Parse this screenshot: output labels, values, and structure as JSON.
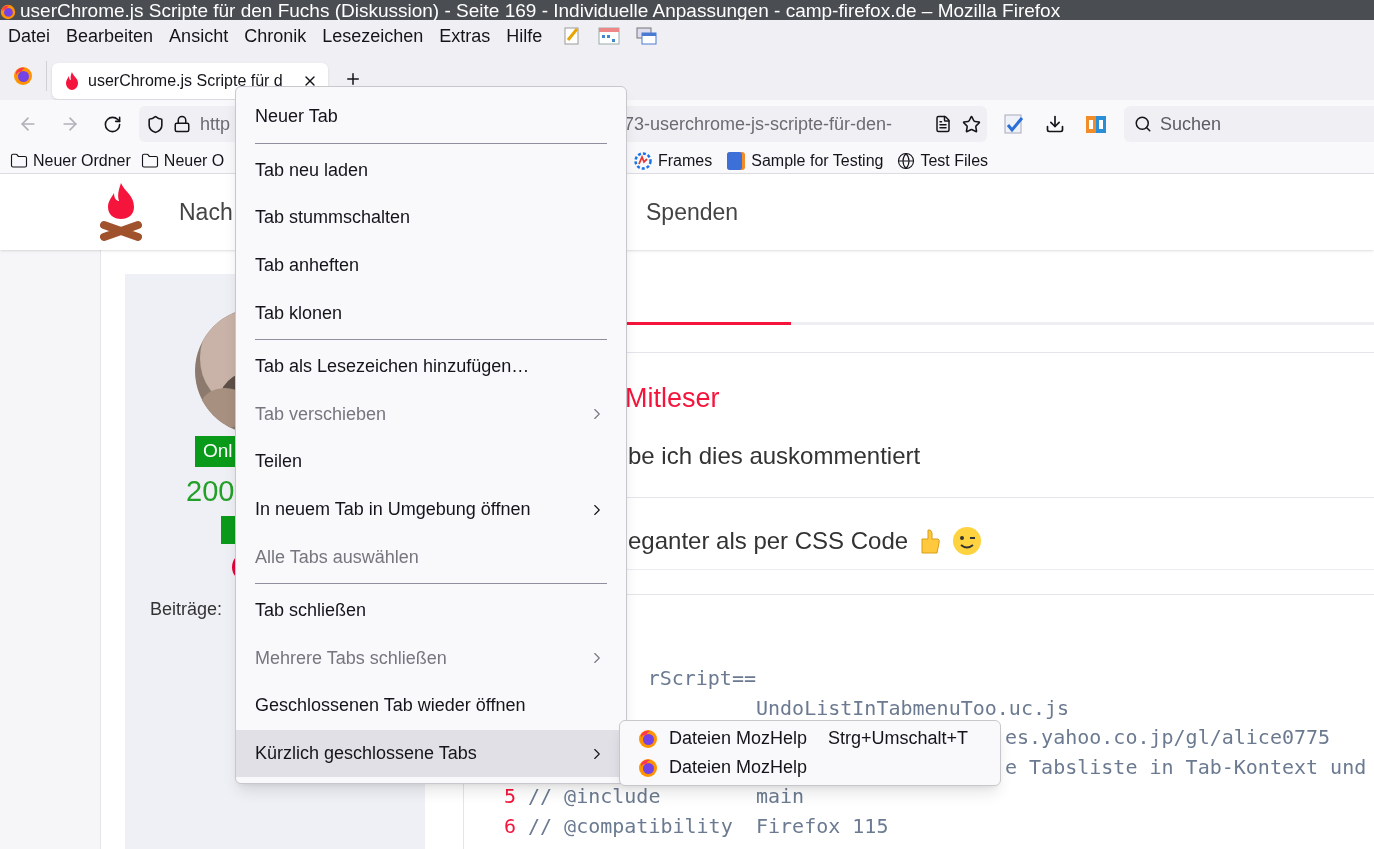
{
  "window": {
    "title": "userChrome.js Scripte für den Fuchs (Diskussion) - Seite 169 - Individuelle Anpassungen - camp-firefox.de – Mozilla Firefox"
  },
  "menu_bar": [
    {
      "label": "Datei"
    },
    {
      "label": "Bearbeiten"
    },
    {
      "label": "Ansicht"
    },
    {
      "label": "Chronik"
    },
    {
      "label": "Lesezeichen"
    },
    {
      "label": "Extras"
    },
    {
      "label": "Hilfe"
    }
  ],
  "tab": {
    "title": "userChrome.js Scripte für d"
  },
  "address_bar": {
    "url_start": "http",
    "url_end": "73-userchrome-js-scripte-für-den-"
  },
  "search": {
    "placeholder": "Suchen"
  },
  "bookmarks": [
    {
      "label": "Neuer Ordner",
      "kind": "folder"
    },
    {
      "label": "Neuer O",
      "kind": "folder"
    },
    {
      "label": "Frames",
      "kind": "frames"
    },
    {
      "label": "Sample for Testing",
      "kind": "sample"
    },
    {
      "label": "Test Files",
      "kind": "globe"
    }
  ],
  "site_nav": [
    {
      "label": "Nach"
    },
    {
      "label": "Spenden"
    }
  ],
  "profile": {
    "status": "Onl",
    "count": "200",
    "posts_label": "Beiträge:"
  },
  "post": {
    "title": "Mitleser",
    "line_1": "be ich dies auskommentiert",
    "line_2": "eganter als per CSS Code"
  },
  "code_lines": [
    {
      "kind": "partial",
      "directive": "rScript=="
    },
    {
      "kind": "value",
      "value": "UndoListInTabmenuToo.uc.js"
    },
    {
      "kind": "covered",
      "value": "es.yahoo.co.jp/gl/alice0775"
    },
    {
      "kind": "covered",
      "value": "e Tabsliste in Tab-Kontext und"
    },
    {
      "kind": "full",
      "number": "5",
      "directive": "// @include",
      "value": "main"
    },
    {
      "kind": "full",
      "number": "6",
      "directive": "// @compatibility",
      "value": "Firefox 115"
    }
  ],
  "context_menu": [
    {
      "kind": "item",
      "label": "Neuer Tab",
      "disabled": false,
      "submenu": false,
      "selected": false
    },
    {
      "kind": "separator"
    },
    {
      "kind": "item",
      "label": "Tab neu laden",
      "disabled": false,
      "submenu": false,
      "selected": false
    },
    {
      "kind": "item",
      "label": "Tab stummschalten",
      "disabled": false,
      "submenu": false,
      "selected": false
    },
    {
      "kind": "item",
      "label": "Tab anheften",
      "disabled": false,
      "submenu": false,
      "selected": false
    },
    {
      "kind": "item",
      "label": "Tab klonen",
      "disabled": false,
      "submenu": false,
      "selected": false
    },
    {
      "kind": "separator"
    },
    {
      "kind": "item",
      "label": "Tab als Lesezeichen hinzufügen…",
      "disabled": false,
      "submenu": false,
      "selected": false
    },
    {
      "kind": "item",
      "label": "Tab verschieben",
      "disabled": true,
      "submenu": true,
      "selected": false
    },
    {
      "kind": "item",
      "label": "Teilen",
      "disabled": false,
      "submenu": false,
      "selected": false
    },
    {
      "kind": "item",
      "label": "In neuem Tab in Umgebung öffnen",
      "disabled": false,
      "submenu": true,
      "selected": false
    },
    {
      "kind": "item",
      "label": "Alle Tabs auswählen",
      "disabled": true,
      "submenu": false,
      "selected": false
    },
    {
      "kind": "separator"
    },
    {
      "kind": "item",
      "label": "Tab schließen",
      "disabled": false,
      "submenu": false,
      "selected": false
    },
    {
      "kind": "item",
      "label": "Mehrere Tabs schließen",
      "disabled": true,
      "submenu": true,
      "selected": false
    },
    {
      "kind": "item",
      "label": "Geschlossenen Tab wieder öffnen",
      "disabled": false,
      "submenu": false,
      "selected": false
    },
    {
      "kind": "item",
      "label": "Kürzlich geschlossene Tabs",
      "disabled": false,
      "submenu": true,
      "selected": true
    }
  ],
  "submenu": [
    {
      "label": "Dateien MozHelp",
      "shortcut": "Strg+Umschalt+T"
    },
    {
      "label": "Dateien MozHelp"
    }
  ]
}
